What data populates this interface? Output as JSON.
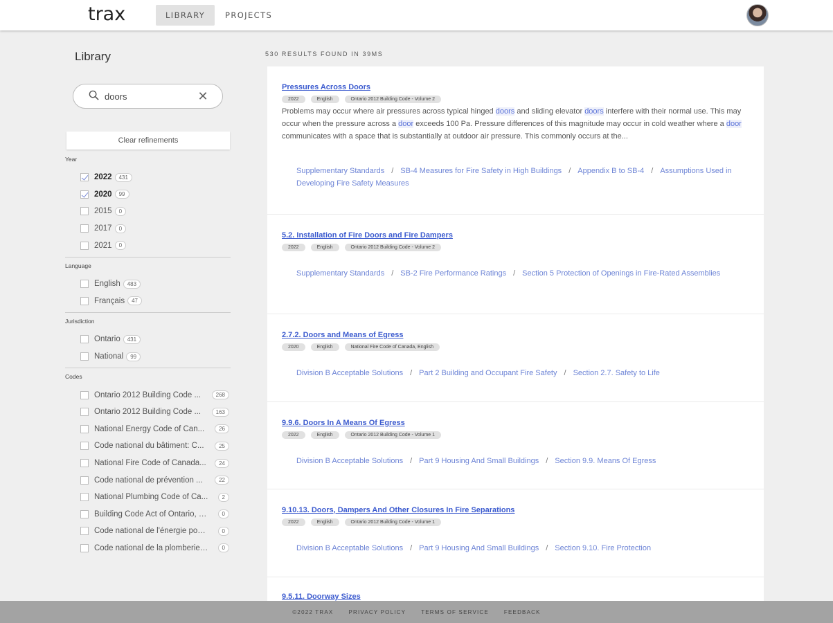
{
  "header": {
    "logo": "trax",
    "tabs": [
      {
        "label": "LIBRARY",
        "active": true
      },
      {
        "label": "PROJECTS",
        "active": false
      }
    ]
  },
  "sidebar": {
    "title": "Library",
    "search": {
      "value": "doors",
      "placeholder": "Search"
    },
    "clear_label": "Clear refinements",
    "facets": {
      "year": {
        "title": "Year",
        "options": [
          {
            "label": "2022",
            "count": "431",
            "checked": true
          },
          {
            "label": "2020",
            "count": "99",
            "checked": true
          },
          {
            "label": "2015",
            "count": "0",
            "checked": false
          },
          {
            "label": "2017",
            "count": "0",
            "checked": false
          },
          {
            "label": "2021",
            "count": "0",
            "checked": false
          }
        ]
      },
      "language": {
        "title": "Language",
        "options": [
          {
            "label": "English",
            "count": "483"
          },
          {
            "label": "Français",
            "count": "47"
          }
        ]
      },
      "jurisdiction": {
        "title": "Jurisdiction",
        "options": [
          {
            "label": "Ontario",
            "count": "431"
          },
          {
            "label": "National",
            "count": "99"
          }
        ]
      },
      "codes": {
        "title": "Codes",
        "options": [
          {
            "label": "Ontario 2012 Building Code ...",
            "count": "268"
          },
          {
            "label": "Ontario 2012 Building Code ...",
            "count": "163"
          },
          {
            "label": "National Energy Code of Can...",
            "count": "26"
          },
          {
            "label": "Code national du bâtiment: C...",
            "count": "25"
          },
          {
            "label": "National Fire Code of Canada...",
            "count": "24"
          },
          {
            "label": "Code national de prévention ...",
            "count": "22"
          },
          {
            "label": "National Plumbing Code of Ca...",
            "count": "2"
          },
          {
            "label": "Building Code Act of Ontario, 1...",
            "count": "0"
          },
          {
            "label": "Code national de l'énergie pou...",
            "count": "0"
          },
          {
            "label": "Code national de la plomberie ...",
            "count": "0"
          }
        ]
      }
    }
  },
  "results": {
    "count_text": "530 RESULTS FOUND IN 39MS",
    "items": [
      {
        "title": "Pressures Across Doors",
        "tags": [
          "2022",
          "English",
          "Ontario 2012 Building Code - Volume 2"
        ],
        "snippet_parts": [
          "Problems may occur where air pressures across typical hinged ",
          "doors",
          " and sliding elevator ",
          "doors",
          " interfere with their normal use. This may occur when the pressure across a ",
          "door",
          " exceeds 100 Pa. Pressure differences of this magnitude may occur in cold weather where a ",
          "door",
          " communicates with a space that is substantially at outdoor air pressure. This commonly occurs at the..."
        ],
        "crumbs": [
          "Supplementary Standards",
          "SB-4 Measures for Fire Safety in High Buildings",
          "Appendix B to SB-4",
          "Assumptions Used in Developing Fire Safety Measures"
        ]
      },
      {
        "title": "5.2. Installation of Fire Doors and Fire Dampers",
        "tags": [
          "2022",
          "English",
          "Ontario 2012 Building Code - Volume 2"
        ],
        "crumbs": [
          "Supplementary Standards",
          "SB-2 Fire Performance Ratings",
          "Section 5 Protection of Openings in Fire-Rated Assemblies"
        ]
      },
      {
        "title": "2.7.2. Doors and Means of Egress",
        "tags": [
          "2020",
          "English",
          "National Fire Code of Canada, English"
        ],
        "crumbs": [
          "Division B Acceptable Solutions",
          "Part 2 Building and Occupant Fire Safety",
          "Section 2.7. Safety to Life"
        ]
      },
      {
        "title": "9.9.6. Doors In A Means Of Egress",
        "tags": [
          "2022",
          "English",
          "Ontario 2012 Building Code - Volume 1"
        ],
        "crumbs": [
          "Division B Acceptable Solutions",
          "Part 9 Housing And Small Buildings",
          "Section 9.9. Means Of Egress"
        ]
      },
      {
        "title": "9.10.13. Doors, Dampers And Other Closures In Fire Separations",
        "tags": [
          "2022",
          "English",
          "Ontario 2012 Building Code - Volume 1"
        ],
        "crumbs": [
          "Division B Acceptable Solutions",
          "Part 9 Housing And Small Buildings",
          "Section 9.10. Fire Protection"
        ]
      },
      {
        "title": "9.5.11. Doorway Sizes",
        "tags": [],
        "crumbs": []
      }
    ]
  },
  "footer": {
    "links": [
      "©2022 TRAX",
      "PRIVACY POLICY",
      "TERMS OF SERVICE",
      "FEEDBACK"
    ]
  },
  "colors": {
    "link": "#3d5ccf",
    "breadcrumb": "#6d84d6",
    "check": "#7a8bd6",
    "footer_bg": "#a3a3a3"
  }
}
